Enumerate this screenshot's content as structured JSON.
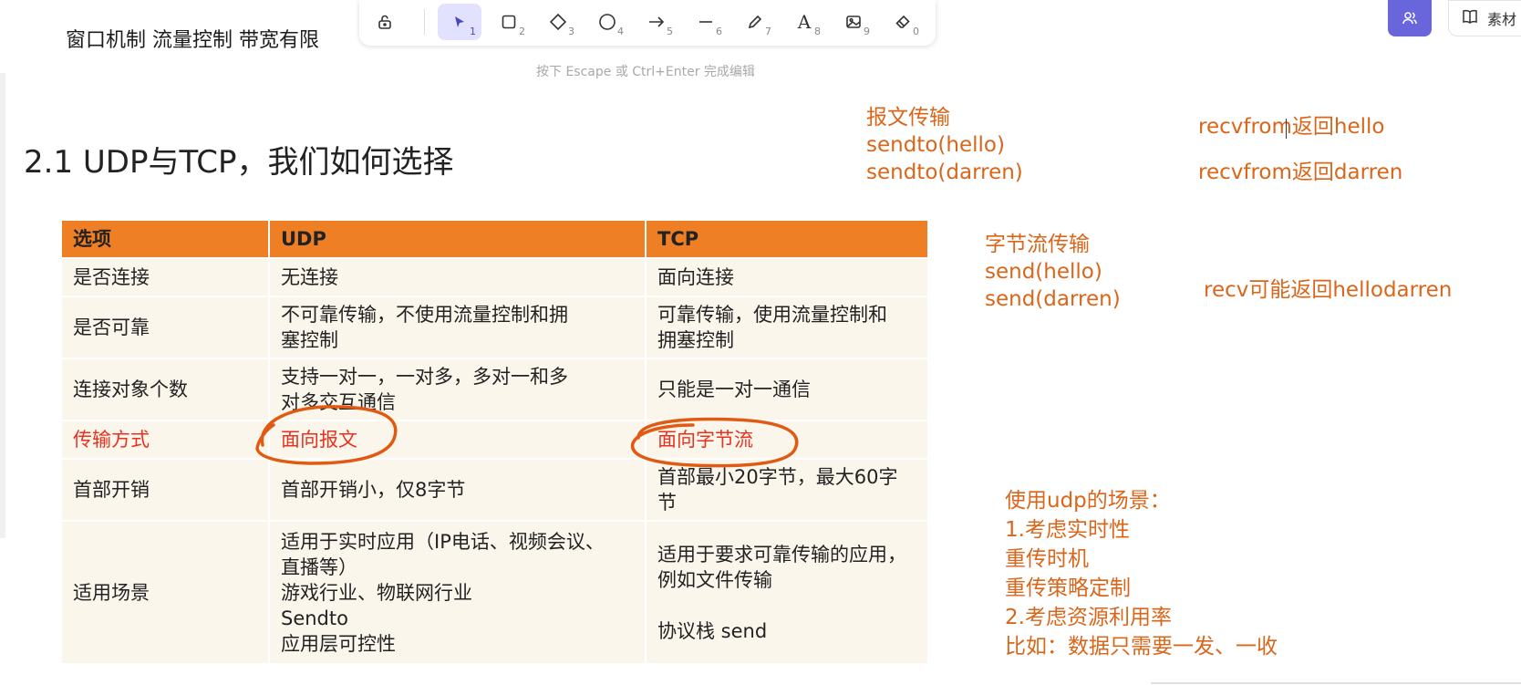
{
  "top_heading": "窗口机制  流量控制 带宽有限",
  "toolbar": {
    "tools": [
      {
        "name": "lock-icon",
        "num": ""
      },
      {
        "name": "selection-icon",
        "num": "1"
      },
      {
        "name": "rectangle-icon",
        "num": "2"
      },
      {
        "name": "diamond-icon",
        "num": "3"
      },
      {
        "name": "ellipse-icon",
        "num": "4"
      },
      {
        "name": "arrow-icon",
        "num": "5"
      },
      {
        "name": "line-icon",
        "num": "6"
      },
      {
        "name": "pencil-icon",
        "num": "7"
      },
      {
        "name": "text-icon",
        "num": "8"
      },
      {
        "name": "image-icon",
        "num": "9"
      },
      {
        "name": "eraser-icon",
        "num": "0"
      }
    ],
    "hint": "按下 Escape 或 Ctrl+Enter 完成编辑"
  },
  "top_right": {
    "library_label": "素材"
  },
  "slide": {
    "title": "2.1 UDP与TCP，我们如何选择",
    "table": {
      "headers": [
        "选项",
        "UDP",
        "TCP"
      ],
      "rows": [
        [
          "是否连接",
          "无连接",
          "面向连接"
        ],
        [
          "是否可靠",
          "不可靠传输，不使用流量控制和拥\n塞控制",
          "可靠传输，使用流量控制和\n拥塞控制"
        ],
        [
          "连接对象个数",
          "支持一对一，一对多，多对一和多\n对多交互通信",
          "只能是一对一通信"
        ],
        [
          "传输方式",
          "面向报文",
          "面向字节流"
        ],
        [
          "首部开销",
          "首部开销小，仅8字节",
          "首部最小20字节，最大60字\n节"
        ],
        [
          "适用场景",
          "适用于实时应用（IP电话、视频会议、\n直播等）\n游戏行业、物联网行业\nSendto\n应用层可控性",
          "适用于要求可靠传输的应用，\n例如文件传输\n\n协议栈 send"
        ]
      ]
    }
  },
  "annotations": {
    "message_transfer": "报文传输\nsendto(hello)\nsendto(darren)",
    "recv1": "recvfrom返回hello",
    "recv2": "recvfrom返回darren",
    "byte_stream": "字节流传输\nsend(hello)\nsend(darren)",
    "recv3": "recv可能返回hellodarren",
    "udp_scenarios": "使用udp的场景：\n1.考虑实时性\n   重传时机\n   重传策略定制\n2.考虑资源利用率\n   比如：数据只需要一发、一收"
  },
  "colors": {
    "header_bg": "#ee7f24",
    "cell_bg": "#fbf6eb",
    "annotation": "#d9661a",
    "highlight_red": "#e8321f",
    "accent": "#6965db"
  }
}
